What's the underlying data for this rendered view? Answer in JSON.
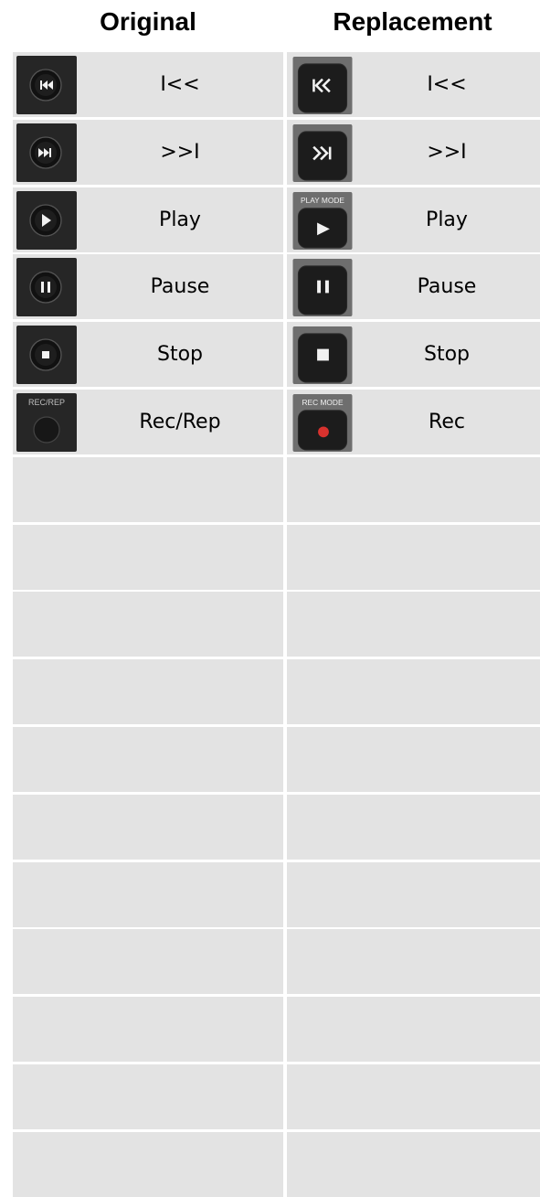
{
  "header": {
    "original": "Original",
    "replacement": "Replacement"
  },
  "rows": [
    {
      "original": {
        "label": "I<<",
        "icon": "skip-back-icon",
        "caption": ""
      },
      "replacement": {
        "label": "I<<",
        "icon": "skip-back-icon",
        "caption": ""
      }
    },
    {
      "original": {
        "label": ">>I",
        "icon": "skip-forward-icon",
        "caption": ""
      },
      "replacement": {
        "label": ">>I",
        "icon": "skip-forward-icon",
        "caption": ""
      }
    },
    {
      "original": {
        "label": "Play",
        "icon": "play-icon",
        "caption": ""
      },
      "replacement": {
        "label": "Play",
        "icon": "play-icon",
        "caption": "PLAY MODE"
      }
    },
    {
      "original": {
        "label": "Pause",
        "icon": "pause-icon",
        "caption": ""
      },
      "replacement": {
        "label": "Pause",
        "icon": "pause-icon",
        "caption": ""
      }
    },
    {
      "original": {
        "label": "Stop",
        "icon": "stop-icon",
        "caption": ""
      },
      "replacement": {
        "label": "Stop",
        "icon": "stop-icon",
        "caption": ""
      }
    },
    {
      "original": {
        "label": "Rec/Rep",
        "icon": "record-icon",
        "caption": "REC/REP"
      },
      "replacement": {
        "label": "Rec",
        "icon": "record-icon",
        "caption": "REC MODE"
      }
    },
    {
      "original": {
        "label": ""
      },
      "replacement": {
        "label": ""
      }
    },
    {
      "original": {
        "label": ""
      },
      "replacement": {
        "label": ""
      }
    },
    {
      "original": {
        "label": ""
      },
      "replacement": {
        "label": ""
      }
    },
    {
      "original": {
        "label": ""
      },
      "replacement": {
        "label": ""
      }
    },
    {
      "original": {
        "label": ""
      },
      "replacement": {
        "label": ""
      }
    },
    {
      "original": {
        "label": ""
      },
      "replacement": {
        "label": ""
      }
    },
    {
      "original": {
        "label": ""
      },
      "replacement": {
        "label": ""
      }
    },
    {
      "original": {
        "label": ""
      },
      "replacement": {
        "label": ""
      }
    },
    {
      "original": {
        "label": ""
      },
      "replacement": {
        "label": ""
      }
    },
    {
      "original": {
        "label": ""
      },
      "replacement": {
        "label": ""
      }
    },
    {
      "original": {
        "label": ""
      },
      "replacement": {
        "label": ""
      }
    }
  ],
  "colors": {
    "cell_background": "#e3e3e3",
    "button_body": "#1c1c1c",
    "original_tile": "#262626",
    "replacement_tile": "#6e6e6e",
    "record_dot": "#d8322e"
  }
}
